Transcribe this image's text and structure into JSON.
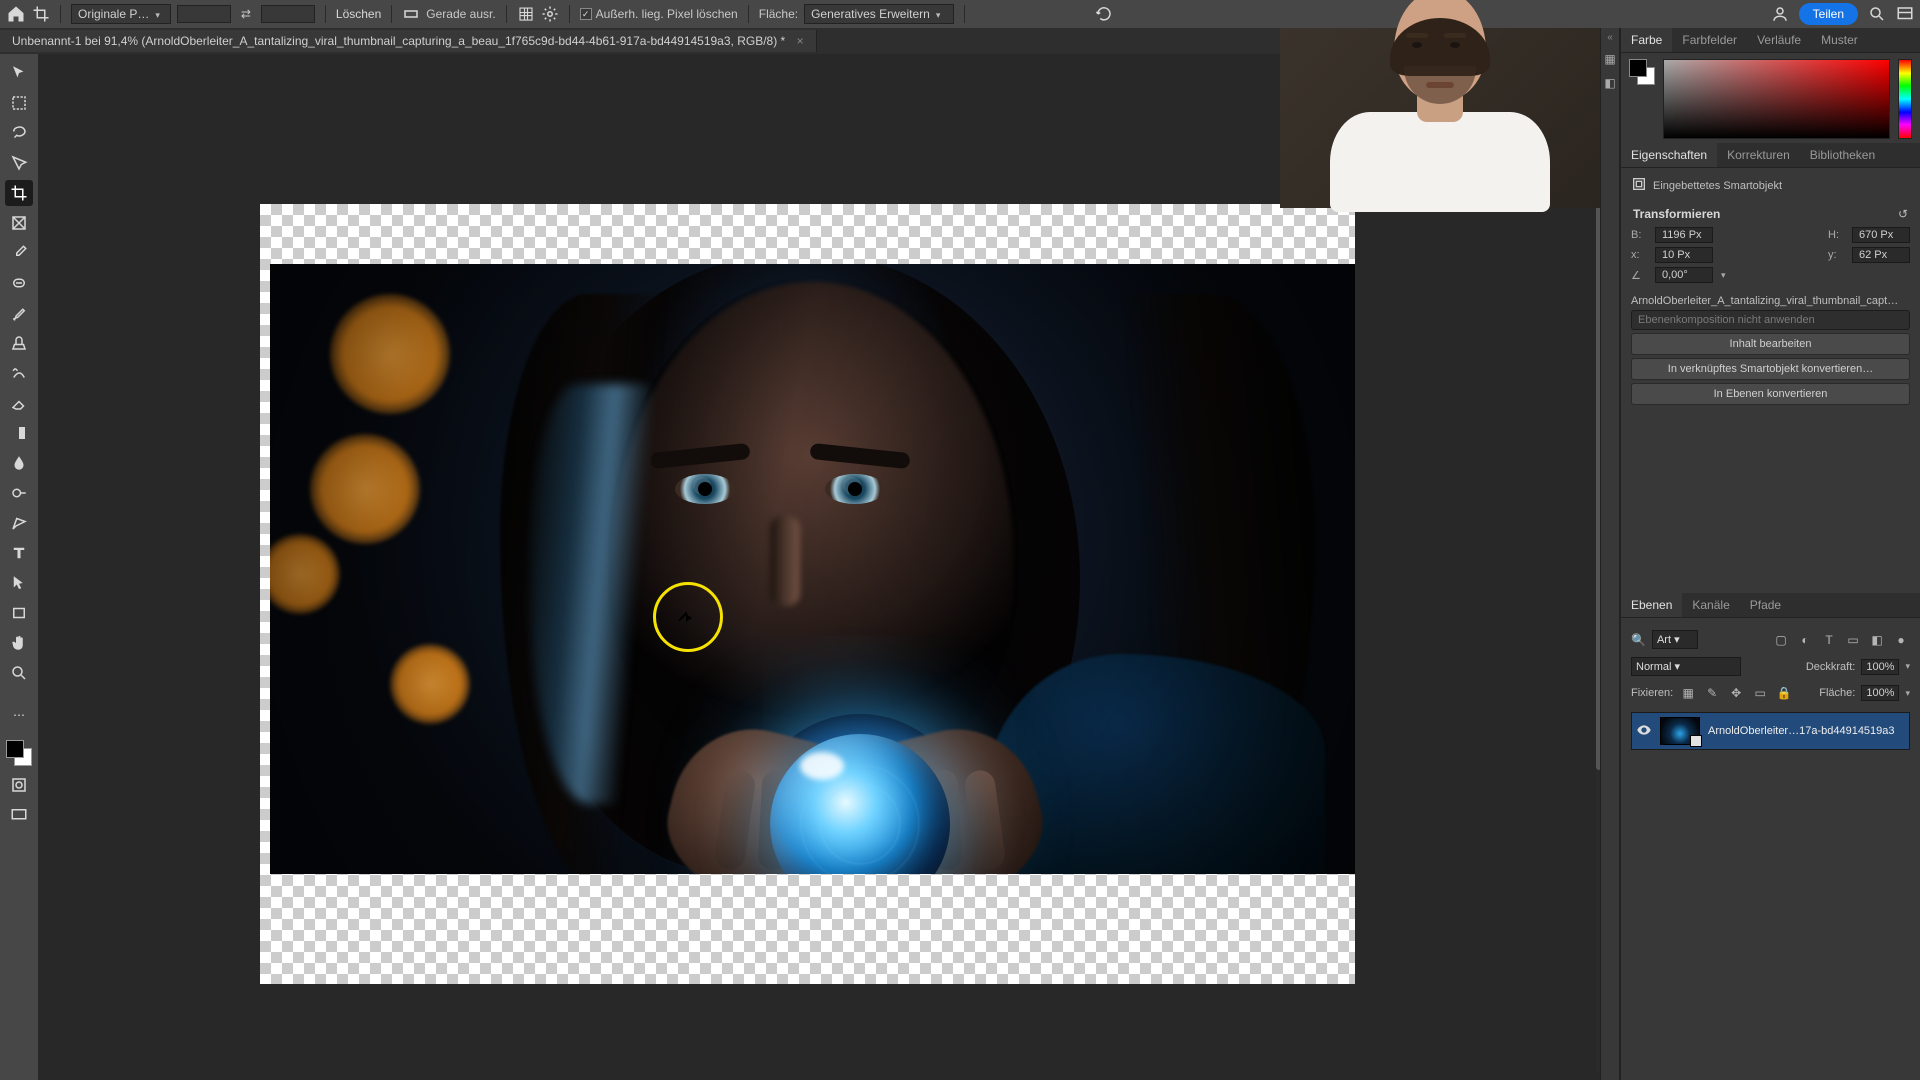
{
  "topbar": {
    "ratio_dropdown": "Originale P…",
    "clear_btn": "Löschen",
    "checkbox_label": "Außerh. lieg. Pixel löschen",
    "fill_label": "Fläche:",
    "fill_dropdown": "Generatives Erweitern",
    "gerade": "Gerade ausr.",
    "share": "Teilen"
  },
  "document": {
    "tab_title": "Unbenannt-1 bei 91,4% (ArnoldOberleiter_A_tantalizing_viral_thumbnail_capturing_a_beau_1f765c9d-bd44-4b61-917a-bd44914519a3, RGB/8) *"
  },
  "panels": {
    "farbe_tabs": [
      "Farbe",
      "Farbfelder",
      "Verläufe",
      "Muster"
    ],
    "eigenschaften_tabs": [
      "Eigenschaften",
      "Korrekturen",
      "Bibliotheken"
    ],
    "ebenen_tabs": [
      "Ebenen",
      "Kanäle",
      "Pfade"
    ]
  },
  "properties": {
    "type_label": "Eingebettetes Smartobjekt",
    "section": "Transformieren",
    "w_lbl": "B:",
    "w_val": "1196 Px",
    "h_lbl": "H:",
    "h_val": "670 Px",
    "x_lbl": "x:",
    "x_val": "10 Px",
    "y_lbl": "y:",
    "y_val": "62 Px",
    "angle_lbl": "∠",
    "angle_val": "0,00°",
    "so_name": "ArnoldOberleiter_A_tantalizing_viral_thumbnail_capt…",
    "layer_comp_placeholder": "Ebenenkomposition nicht anwenden",
    "btn_edit": "Inhalt bearbeiten",
    "btn_convert_linked": "In verknüpftes Smartobjekt konvertieren…",
    "btn_convert_layers": "In Ebenen konvertieren"
  },
  "layers": {
    "search_lbl": "Art",
    "blend_mode": "Normal",
    "opacity_lbl": "Deckkraft:",
    "opacity_val": "100%",
    "lock_lbl": "Fixieren:",
    "fill_lbl": "Fläche:",
    "fill_val": "100%",
    "layer_name": "ArnoldOberleiter…17a-bd44914519a3"
  }
}
